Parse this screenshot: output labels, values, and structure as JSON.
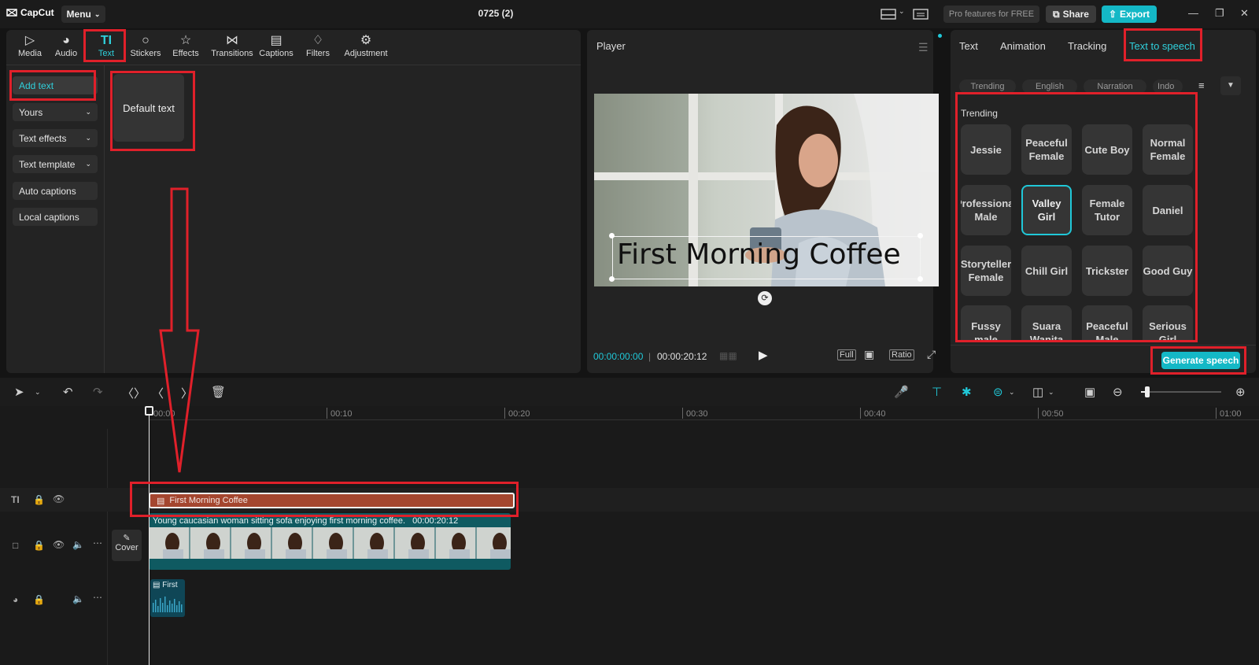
{
  "app": {
    "logo_text": "CapCut",
    "menu_label": "Menu",
    "project_title": "0725 (2)",
    "pro_features": "Pro features for FREE",
    "share_label": "Share",
    "export_label": "Export"
  },
  "tools": [
    {
      "label": "Media",
      "icon": "media-icon"
    },
    {
      "label": "Audio",
      "icon": "audio-icon"
    },
    {
      "label": "Text",
      "icon": "text-icon",
      "active": true
    },
    {
      "label": "Stickers",
      "icon": "sticker-icon"
    },
    {
      "label": "Effects",
      "icon": "effects-icon"
    },
    {
      "label": "Transitions",
      "icon": "transitions-icon"
    },
    {
      "label": "Captions",
      "icon": "captions-icon"
    },
    {
      "label": "Filters",
      "icon": "filters-icon"
    },
    {
      "label": "Adjustment",
      "icon": "adjustment-icon"
    }
  ],
  "sidebar": {
    "items": [
      {
        "label": "Add text",
        "active": true
      },
      {
        "label": "Yours",
        "dropdown": true
      },
      {
        "label": "Text effects",
        "dropdown": true
      },
      {
        "label": "Text template",
        "dropdown": true
      },
      {
        "label": "Auto captions"
      },
      {
        "label": "Local captions"
      }
    ]
  },
  "content": {
    "default_text_card": "Default text"
  },
  "player": {
    "title": "Player",
    "overlay_text": "First Morning Coffee",
    "current_time": "00:00:00:00",
    "total_time": "00:00:20:12",
    "full_label": "Full",
    "ratio_label": "Ratio"
  },
  "right_panel": {
    "tabs": [
      {
        "label": "Text"
      },
      {
        "label": "Animation"
      },
      {
        "label": "Tracking"
      },
      {
        "label": "Text to speech",
        "active": true
      }
    ],
    "filter_chips": [
      "Trending",
      "English",
      "Narration",
      "Indo"
    ],
    "section_label": "Trending",
    "voices": [
      "Jessie",
      "Peaceful Female",
      "Cute Boy",
      "Normal Female",
      "Professional Male",
      "Valley Girl",
      "Female Tutor",
      "Daniel",
      "Storyteller Female",
      "Chill Girl",
      "Trickster",
      "Good Guy",
      "Fussy male",
      "Suara Wanita",
      "Peaceful Male",
      "Serious Girl"
    ],
    "selected_voice": "Valley Girl",
    "generate_label": "Generate speech"
  },
  "timeline": {
    "ruler": [
      "00:00",
      "00:10",
      "00:20",
      "00:30",
      "00:40",
      "00:50",
      "01:00"
    ],
    "text_clip_label": "First Morning Coffee",
    "video_clip_label": "Young caucasian woman sitting sofa enjoying first morning coffee.",
    "video_clip_duration": "00:00:20:12",
    "audio_clip_label": "First",
    "cover_label": "Cover"
  },
  "colors": {
    "accent": "#14b8c6",
    "highlight_box": "#e0202a",
    "text_clip": "#a4462f",
    "video_clip": "#0f5a61"
  }
}
